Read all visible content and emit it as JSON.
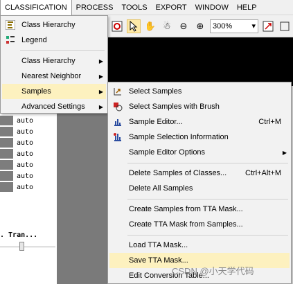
{
  "menubar": {
    "items": [
      {
        "label": "CLASSIFICATION",
        "active": true
      },
      {
        "label": "PROCESS"
      },
      {
        "label": "TOOLS"
      },
      {
        "label": "EXPORT"
      },
      {
        "label": "WINDOW"
      },
      {
        "label": "HELP"
      }
    ]
  },
  "toolbar": {
    "zoom_value": "300%",
    "zoom_arrow": "▾"
  },
  "classification_menu": {
    "class_hierarchy": "Class Hierarchy",
    "legend": "Legend",
    "class_hierarchy_sub": "Class Hierarchy",
    "nearest_neighbor": "Nearest Neighbor",
    "samples": "Samples",
    "advanced_settings": "Advanced Settings"
  },
  "samples_menu": {
    "select_samples": "Select Samples",
    "select_with_brush": "Select Samples with Brush",
    "sample_editor": "Sample Editor...",
    "sample_editor_shortcut": "Ctrl+M",
    "selection_info": "Sample Selection Information",
    "editor_options": "Sample Editor Options",
    "delete_of_classes": "Delete Samples of Classes...",
    "delete_of_classes_shortcut": "Ctrl+Alt+M",
    "delete_all": "Delete All Samples",
    "create_from_tta": "Create Samples from TTA Mask...",
    "create_tta_from_samples": "Create TTA Mask from Samples...",
    "load_tta": "Load TTA Mask...",
    "save_tta": "Save TTA Mask...",
    "edit_conversion": "Edit Conversion Table..."
  },
  "left_panel": {
    "rows": [
      "auto",
      "auto",
      "auto",
      "auto",
      "auto",
      "auto",
      "auto"
    ],
    "footer": ". Tran..."
  },
  "watermark": "CSDN @小天学代码",
  "colors": {
    "highlight": "#fdf1bf",
    "menu_bg": "#f2f2f2"
  }
}
